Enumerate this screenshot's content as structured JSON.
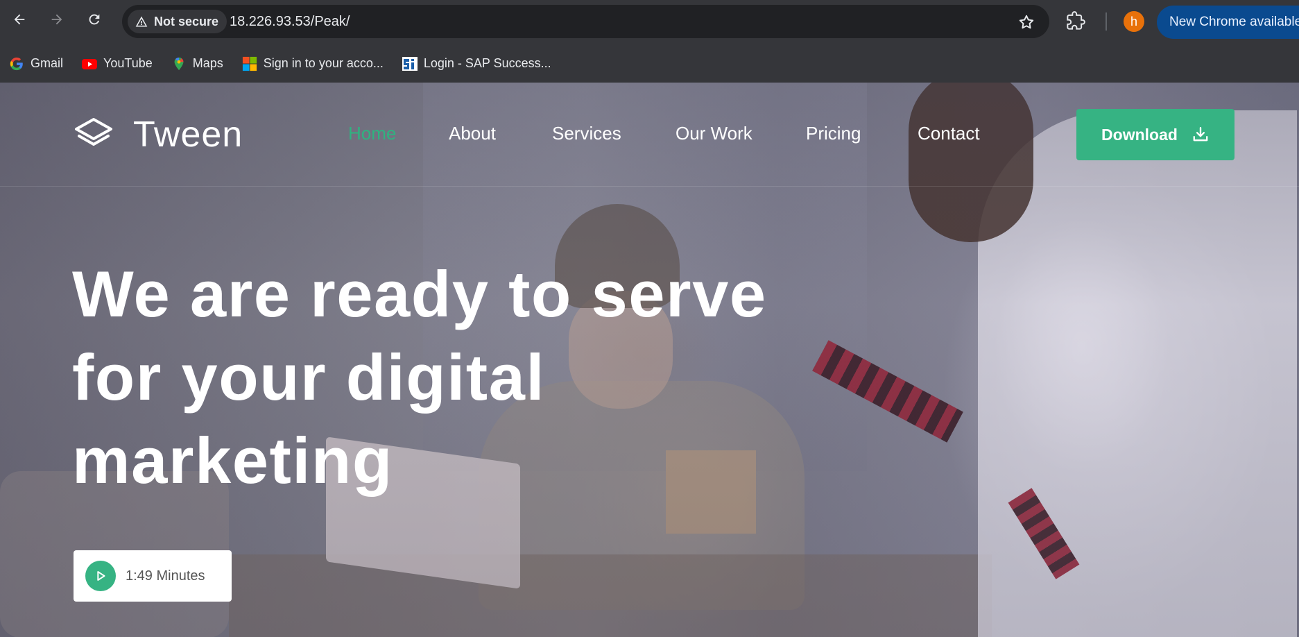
{
  "browser": {
    "security_label": "Not secure",
    "url": "18.226.93.53/Peak/",
    "avatar_letter": "h",
    "update_label": "New Chrome available",
    "bookmarks": [
      {
        "label": "Gmail",
        "icon": "google-icon"
      },
      {
        "label": "YouTube",
        "icon": "youtube-icon"
      },
      {
        "label": "Maps",
        "icon": "maps-pin-icon"
      },
      {
        "label": "Sign in to your acco...",
        "icon": "microsoft-icon"
      },
      {
        "label": "Login - SAP Success...",
        "icon": "sap-si-icon"
      }
    ]
  },
  "site": {
    "logo_text": "Tween",
    "nav": [
      {
        "label": "Home",
        "active": true
      },
      {
        "label": "About"
      },
      {
        "label": "Services"
      },
      {
        "label": "Our Work"
      },
      {
        "label": "Pricing"
      },
      {
        "label": "Contact"
      }
    ],
    "download_label": "Download",
    "accent_color": "#36b383"
  },
  "hero": {
    "title_lines": [
      "We are ready to serve",
      "for your digital",
      "marketing"
    ],
    "video_label": "1:49 Minutes"
  }
}
